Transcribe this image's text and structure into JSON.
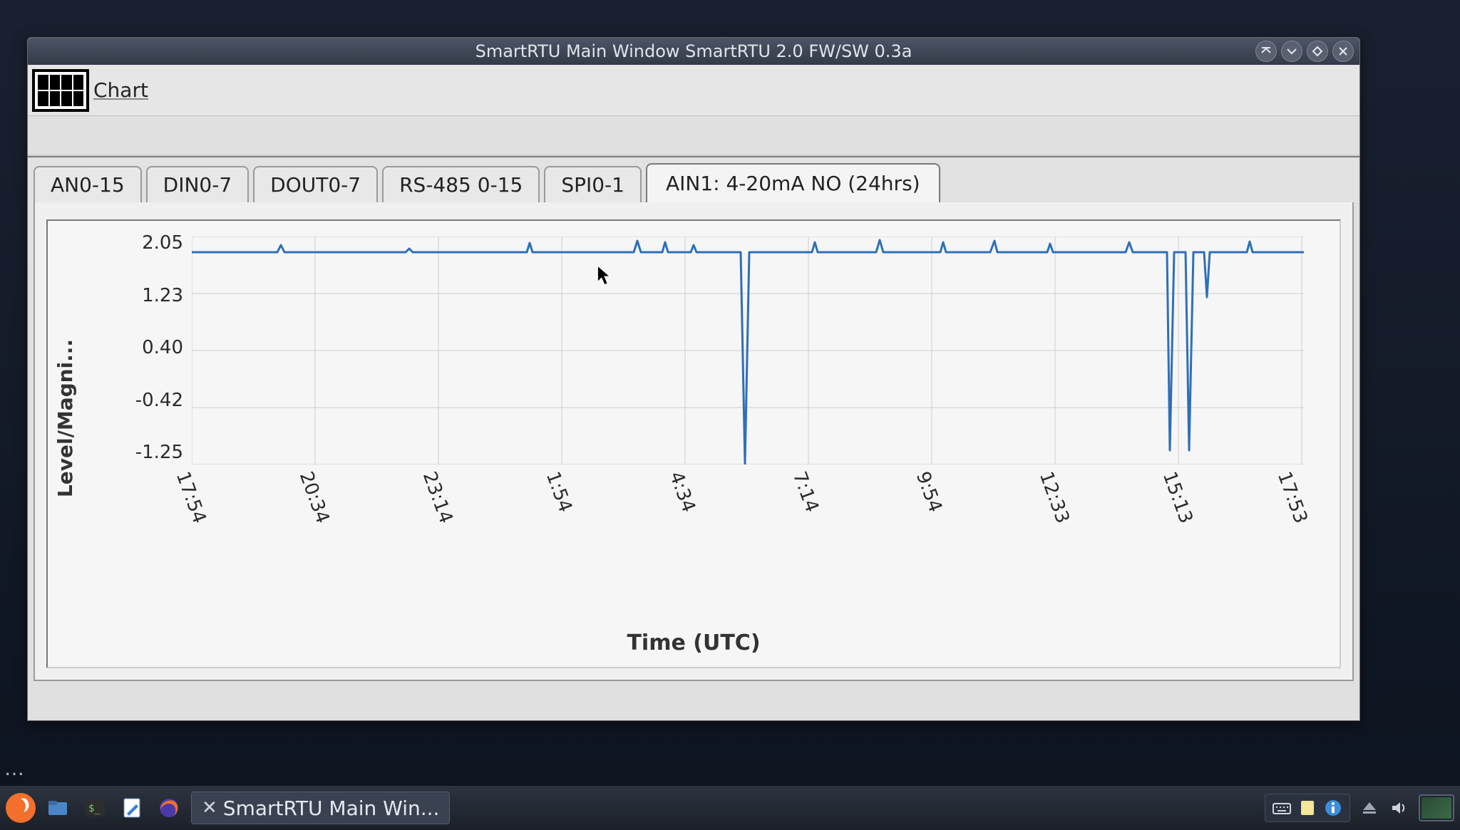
{
  "window": {
    "title": "SmartRTU Main Window SmartRTU 2.0 FW/SW 0.3a"
  },
  "menu": {
    "chart_label": "Chart"
  },
  "tabs": [
    {
      "label": "AN0-15",
      "active": false
    },
    {
      "label": "DIN0-7",
      "active": false
    },
    {
      "label": "DOUT0-7",
      "active": false
    },
    {
      "label": "RS-485 0-15",
      "active": false
    },
    {
      "label": "SPI0-1",
      "active": false
    },
    {
      "label": "AIN1: 4-20mA NO (24hrs)",
      "active": true
    }
  ],
  "chart_data": {
    "type": "line",
    "title": "",
    "xlabel": "Time (UTC)",
    "ylabel": "Level/Magni...",
    "ylim": [
      -1.25,
      2.05
    ],
    "yticks": [
      "2.05",
      "1.23",
      "0.40",
      "-0.42",
      "-1.25"
    ],
    "xticks": [
      "17:54",
      "20:34",
      "23:14",
      "1:54",
      "4:34",
      "7:14",
      "9:54",
      "12:33",
      "15:13",
      "17:53"
    ],
    "series": [
      {
        "name": "AIN1",
        "color": "#2f6fb8",
        "values_at_xticks": [
          1.95,
          1.95,
          1.95,
          1.98,
          1.95,
          1.95,
          1.95,
          1.95,
          1.95,
          1.95
        ],
        "notable_spikes": [
          {
            "approx_time": "~5:50",
            "value": -1.25
          },
          {
            "approx_time": "~15:05",
            "value": -1.05
          },
          {
            "approx_time": "~15:20",
            "value": -1.05
          },
          {
            "approx_time": "~15:35",
            "value": 1.2
          }
        ]
      }
    ]
  },
  "taskbar": {
    "active_window_label": "SmartRTU Main Win..."
  }
}
